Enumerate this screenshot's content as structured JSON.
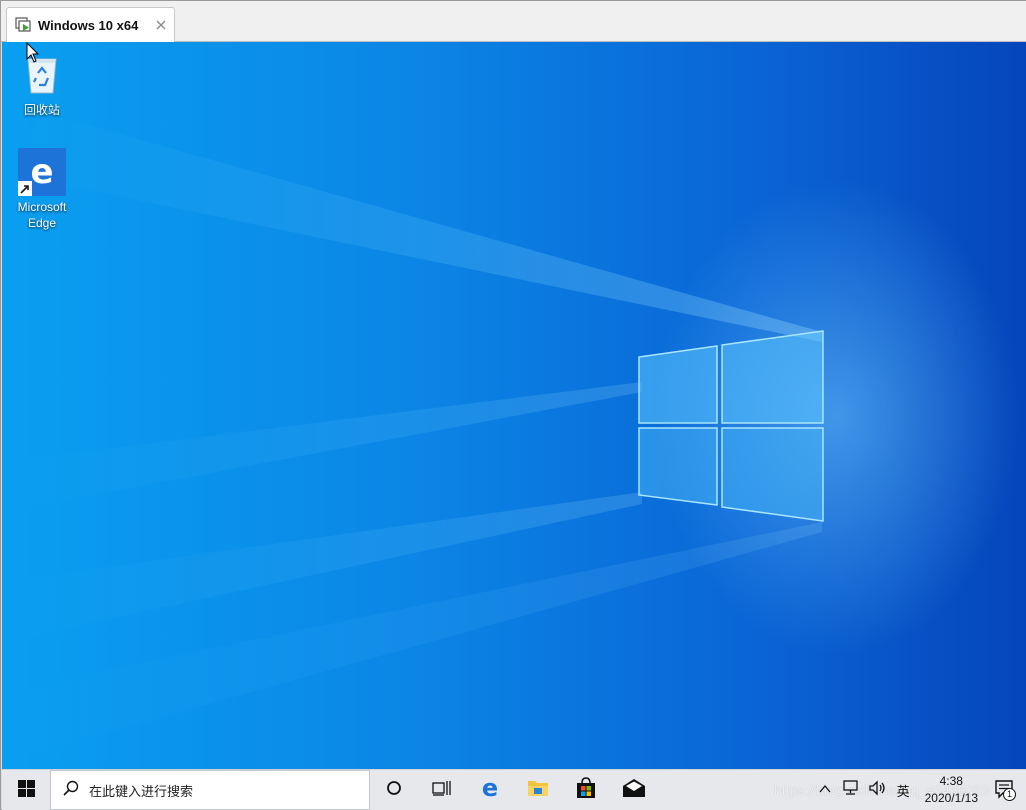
{
  "vm_tab": {
    "title": "Windows 10 x64",
    "close_symbol": "×"
  },
  "desktop": {
    "icons": [
      {
        "label": "回收站",
        "icon": "recycle-bin-icon"
      },
      {
        "label": "Microsoft\nEdge",
        "icon": "edge-icon"
      }
    ]
  },
  "taskbar": {
    "search_placeholder": "在此键入进行搜索",
    "ime_label": "英",
    "clock_time": "4:38",
    "clock_date": "2020/1/13",
    "notification_count": "1",
    "pinned": [
      "cortana-icon",
      "task-view-icon",
      "edge-icon",
      "file-explorer-icon",
      "store-icon",
      "mail-icon"
    ]
  },
  "watermark": "https://blog.csdn.net/qq_45436053",
  "colors": {
    "desktop_light": "#0a9ff0",
    "desktop_dark": "#0545bb",
    "taskbar_bg": "#e6e8ec",
    "edge_blue": "#1e73d8"
  }
}
